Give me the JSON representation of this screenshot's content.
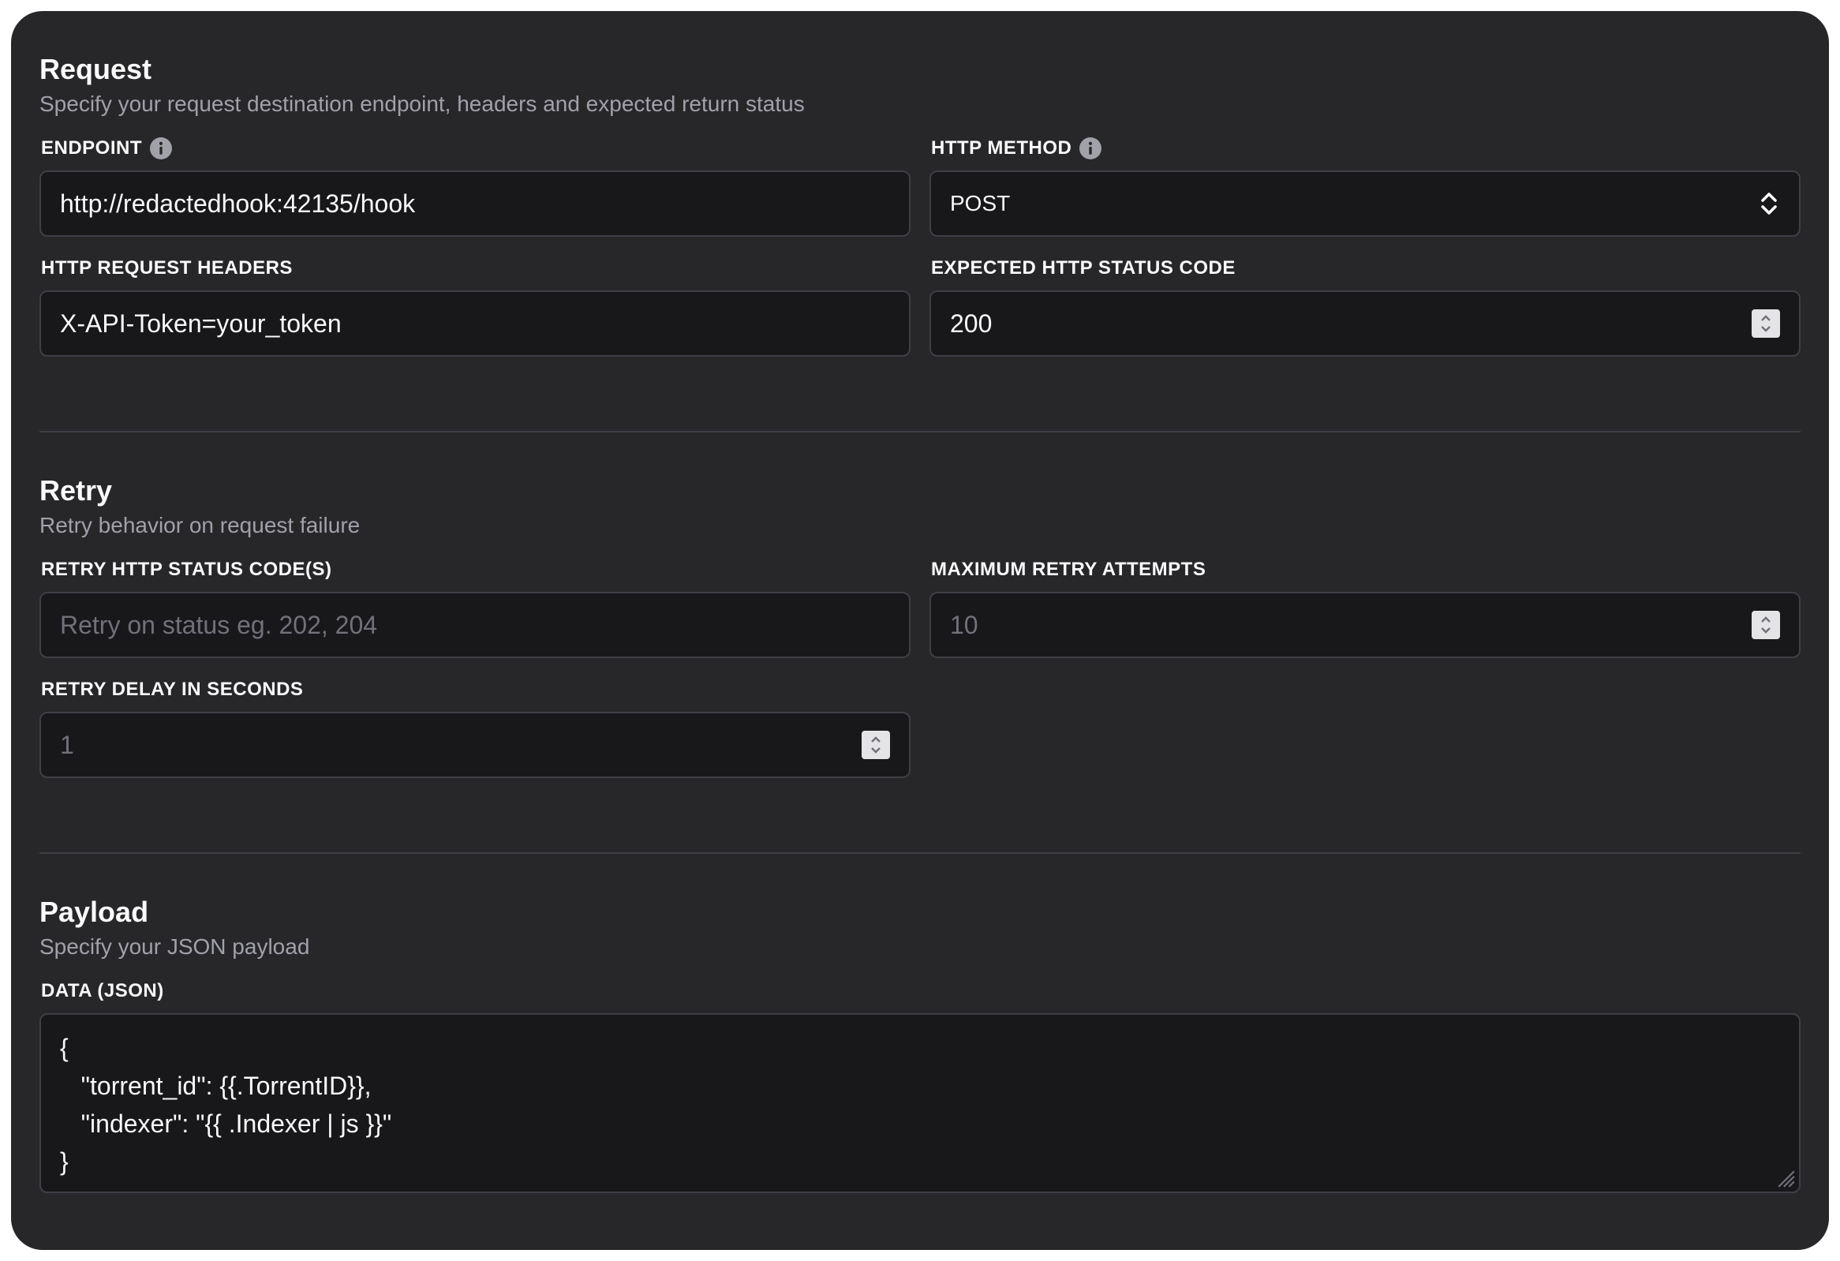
{
  "request": {
    "title": "Request",
    "subtitle": "Specify your request destination endpoint, headers and expected return status",
    "endpoint": {
      "label": "ENDPOINT",
      "value": "http://redactedhook:42135/hook"
    },
    "method": {
      "label": "HTTP METHOD",
      "value": "POST"
    },
    "headers": {
      "label": "HTTP REQUEST HEADERS",
      "value": "X-API-Token=your_token"
    },
    "status": {
      "label": "EXPECTED HTTP STATUS CODE",
      "value": "200"
    }
  },
  "retry": {
    "title": "Retry",
    "subtitle": "Retry behavior on request failure",
    "codes": {
      "label": "RETRY HTTP STATUS CODE(S)",
      "placeholder": "Retry on status eg. 202, 204"
    },
    "attempts": {
      "label": "MAXIMUM RETRY ATTEMPTS",
      "placeholder": "10"
    },
    "delay": {
      "label": "RETRY DELAY IN SECONDS",
      "placeholder": "1"
    }
  },
  "payload": {
    "title": "Payload",
    "subtitle": "Specify your JSON payload",
    "data": {
      "label": "DATA (JSON)",
      "lines": [
        "{",
        "   \"torrent_id\": {{.TorrentID}},",
        "   \"indexer\": \"{{ .Indexer | js }}\"",
        "}"
      ]
    }
  },
  "icons": {
    "info": "info-icon",
    "select": "chevron-up-down-icon",
    "spinner": "number-spinner-icon",
    "resize": "resize-handle-icon"
  },
  "colors": {
    "card_bg": "#27272a",
    "input_bg": "#18181b",
    "border": "#3f3f46",
    "text": "#fafafa",
    "muted": "#a1a1aa",
    "placeholder": "#71717a"
  }
}
